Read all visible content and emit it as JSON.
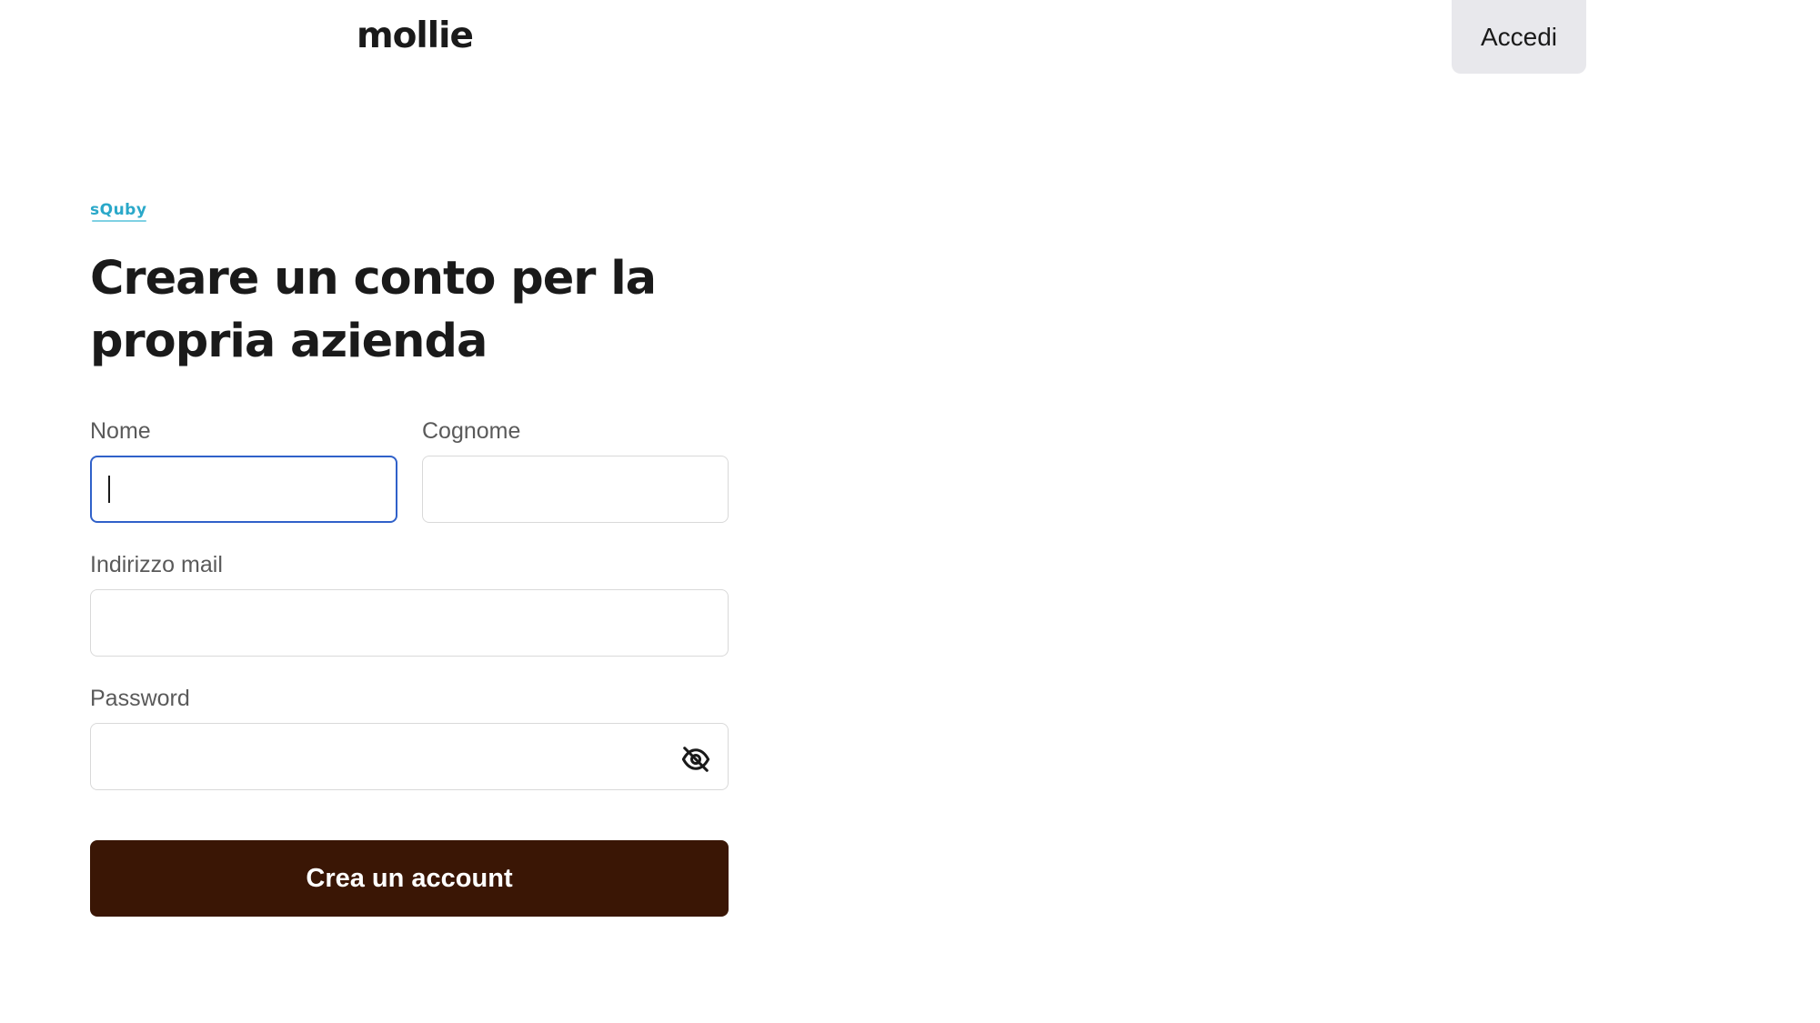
{
  "header": {
    "logo_text": "mollie",
    "login_label": "Accedi"
  },
  "merchant": {
    "logo_text": "sQuby",
    "logo_color": "#2aa8c9"
  },
  "form": {
    "title": "Creare un conto per la propria azienda",
    "first_name": {
      "label": "Nome",
      "value": ""
    },
    "last_name": {
      "label": "Cognome",
      "value": ""
    },
    "email": {
      "label": "Indirizzo mail",
      "value": ""
    },
    "password": {
      "label": "Password",
      "value": "",
      "toggle_icon": "eye-off-icon"
    },
    "submit_label": "Crea un account"
  },
  "colors": {
    "primary_button": "#3a1605",
    "focus_border": "#3061c9",
    "secondary_button_bg": "#e8e8ec"
  }
}
